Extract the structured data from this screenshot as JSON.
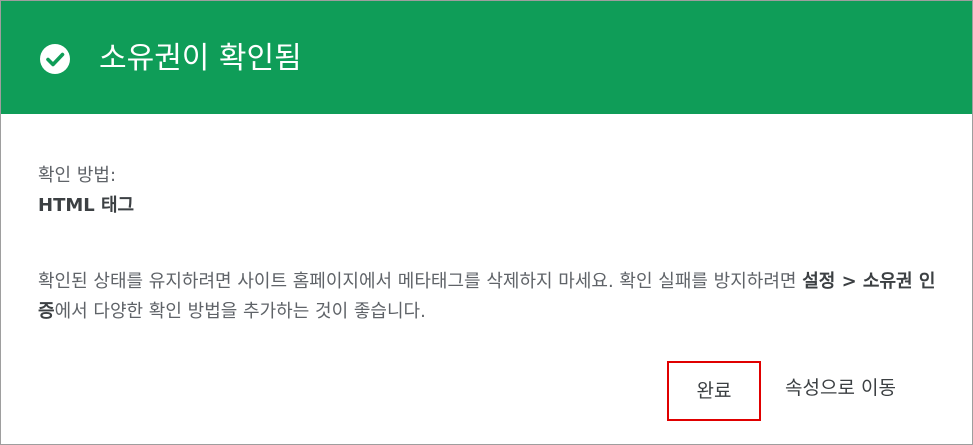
{
  "dialog": {
    "title": "소유권이 확인됨",
    "check_icon": "check-circle-icon",
    "header_color": "#0f9d58"
  },
  "method": {
    "label": "확인 방법:",
    "value": "HTML 태그"
  },
  "message": {
    "part1": "확인된 상태를 유지하려면 사이트 홈페이지에서 메타태그를 삭제하지 마세요. 확인 실패를 방지하려면 ",
    "bold": "설정 > 소유권 인증",
    "part2": "에서 다양한 확인 방법을 추가하는 것이 좋습니다."
  },
  "actions": {
    "done_label": "완료",
    "go_label": "속성으로 이동"
  }
}
